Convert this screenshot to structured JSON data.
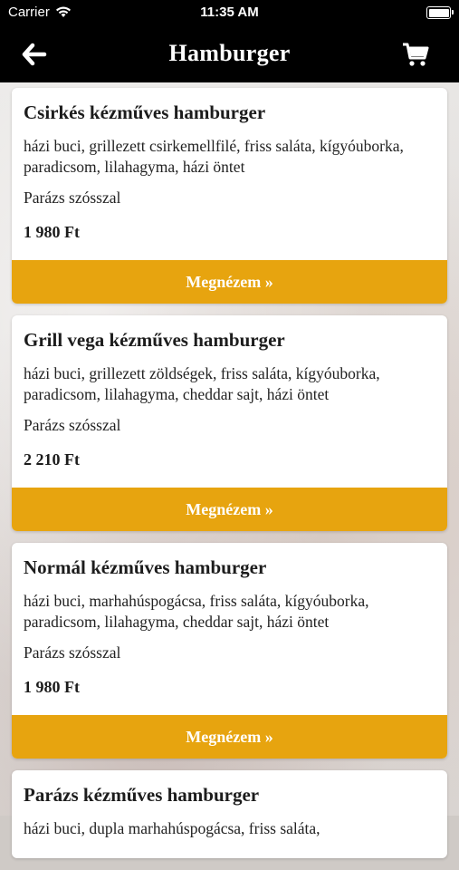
{
  "status_bar": {
    "carrier": "Carrier",
    "time": "11:35 AM"
  },
  "nav": {
    "title": "Hamburger"
  },
  "colors": {
    "accent": "#e7a40f",
    "bar": "#000000"
  },
  "items": [
    {
      "name": "Csirkés kézműves hamburger",
      "description": "házi buci, grillezett csirkemellfilé, friss saláta, kígyóuborka, paradicsom, lilahagyma, házi öntet",
      "option": "Parázs szósszal",
      "price": "1 980 Ft",
      "button": "Megnézem »"
    },
    {
      "name": "Grill vega kézműves hamburger",
      "description": "házi buci, grillezett zöldségek, friss saláta, kígyóuborka, paradicsom, lilahagyma, cheddar sajt, házi öntet",
      "option": "Parázs szósszal",
      "price": "2 210 Ft",
      "button": "Megnézem »"
    },
    {
      "name": "Normál kézműves hamburger",
      "description": "házi buci, marhahúspogácsa, friss saláta, kígyóuborka, paradicsom, lilahagyma, cheddar sajt, házi öntet",
      "option": "Parázs szósszal",
      "price": "1 980 Ft",
      "button": "Megnézem »"
    },
    {
      "name": "Parázs kézműves hamburger",
      "description": "házi buci, dupla marhahúspogácsa, friss saláta,",
      "option": "",
      "price": "",
      "button": ""
    }
  ]
}
